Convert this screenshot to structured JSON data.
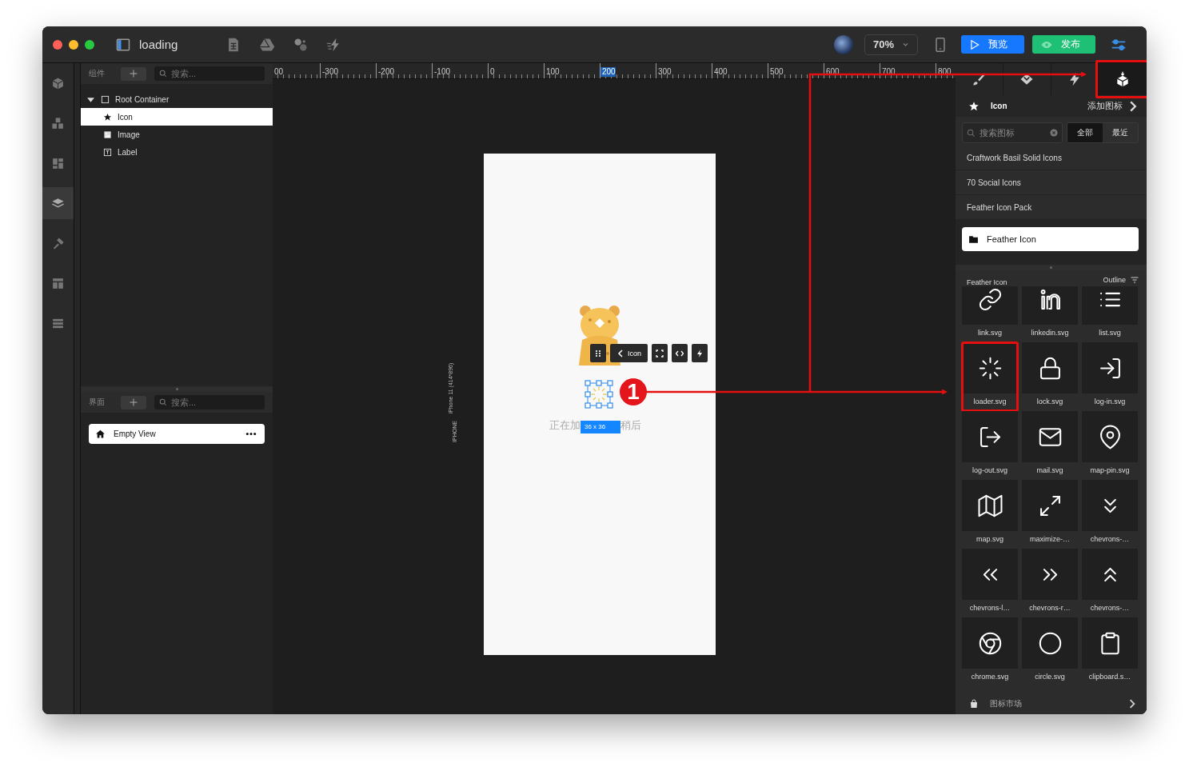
{
  "window": {
    "title": "loading"
  },
  "toolbar": {
    "zoom": "70%",
    "preview_button": "预览",
    "publish_button": "发布"
  },
  "rail": [
    {
      "kind": "cube",
      "selected": false
    },
    {
      "kind": "cubes",
      "selected": false
    },
    {
      "kind": "dashboard",
      "selected": false
    },
    {
      "kind": "layers",
      "selected": true
    },
    {
      "kind": "hammer",
      "selected": false
    },
    {
      "kind": "template",
      "selected": false
    },
    {
      "kind": "rows",
      "selected": false
    }
  ],
  "components_panel": {
    "title": "组件",
    "search_placeholder": "搜索...",
    "tree": [
      {
        "label": "Root Container",
        "kind": "container",
        "expanded": true,
        "selected": false,
        "children": [
          {
            "label": "Icon",
            "kind": "icon",
            "selected": true
          },
          {
            "label": "Image",
            "kind": "image",
            "selected": false
          },
          {
            "label": "Label",
            "kind": "label",
            "selected": false
          }
        ]
      }
    ]
  },
  "screens_panel": {
    "title": "界面",
    "search_placeholder": "搜索...",
    "screens": [
      {
        "label": "Empty View",
        "selected": true
      }
    ]
  },
  "ruler": {
    "labels": [
      {
        "text": "00",
        "selected": false
      },
      {
        "text": "-300",
        "selected": false
      },
      {
        "text": "-200",
        "selected": false
      },
      {
        "text": "-100",
        "selected": false
      },
      {
        "text": "0",
        "selected": false
      },
      {
        "text": "100",
        "selected": false
      },
      {
        "text": "200",
        "selected": true
      },
      {
        "text": "300",
        "selected": false
      },
      {
        "text": "400",
        "selected": false
      },
      {
        "text": "500",
        "selected": false
      },
      {
        "text": "600",
        "selected": false
      },
      {
        "text": "700",
        "selected": false
      },
      {
        "text": "800",
        "selected": false
      }
    ]
  },
  "canvas": {
    "device_name": "IPHONE",
    "device_model": "iPhone 11 (414*896)",
    "element_toolbar": {
      "breadcrumb": "Icon"
    },
    "size_badge": "36 x 36",
    "loading_text": [
      "正在加",
      "稍后"
    ],
    "marker": "1"
  },
  "inspector": {
    "tabs": [
      {
        "kind": "brush",
        "selected": false,
        "annotated": false
      },
      {
        "kind": "diamond",
        "selected": false,
        "annotated": false
      },
      {
        "kind": "bolt",
        "selected": false,
        "annotated": false
      },
      {
        "kind": "package",
        "selected": true,
        "annotated": true
      }
    ],
    "component": "Icon",
    "add_icon_link": "添加图标",
    "search": {
      "placeholder": "搜索图标"
    },
    "filters": [
      {
        "label": "全部",
        "selected": true
      },
      {
        "label": "最近",
        "selected": false
      }
    ],
    "libraries": [
      {
        "label": "Craftwork Basil Solid Icons",
        "selected": false
      },
      {
        "label": "70 Social Icons",
        "selected": false
      },
      {
        "label": "Feather Icon Pack",
        "selected": false
      },
      {
        "label": "Feather Icon",
        "selected": true
      }
    ],
    "icon_set": {
      "title": "Feather Icon",
      "style": "Outline",
      "icons": [
        {
          "name": "link.svg",
          "kind": "link",
          "annotated": false
        },
        {
          "name": "linkedin.svg",
          "kind": "linkedin",
          "annotated": false
        },
        {
          "name": "list.svg",
          "kind": "list",
          "annotated": false
        },
        {
          "name": "loader.svg",
          "kind": "loader",
          "annotated": true
        },
        {
          "name": "lock.svg",
          "kind": "lock",
          "annotated": false
        },
        {
          "name": "log-in.svg",
          "kind": "log-in",
          "annotated": false
        },
        {
          "name": "log-out.svg",
          "kind": "log-out",
          "annotated": false
        },
        {
          "name": "mail.svg",
          "kind": "mail",
          "annotated": false
        },
        {
          "name": "map-pin.svg",
          "kind": "map-pin",
          "annotated": false
        },
        {
          "name": "map.svg",
          "kind": "map",
          "annotated": false
        },
        {
          "name": "maximize-…",
          "kind": "maximize",
          "annotated": false
        },
        {
          "name": "chevrons-…",
          "kind": "chevrons-down",
          "annotated": false
        },
        {
          "name": "chevrons-l…",
          "kind": "chevrons-left",
          "annotated": false
        },
        {
          "name": "chevrons-r…",
          "kind": "chevrons-right",
          "annotated": false
        },
        {
          "name": "chevrons-…",
          "kind": "chevrons-up",
          "annotated": false
        },
        {
          "name": "chrome.svg",
          "kind": "chrome",
          "annotated": false
        },
        {
          "name": "circle.svg",
          "kind": "circle",
          "annotated": false
        },
        {
          "name": "clipboard.s…",
          "kind": "clipboard",
          "annotated": false
        }
      ]
    },
    "footer": {
      "label": "图标市场"
    }
  }
}
